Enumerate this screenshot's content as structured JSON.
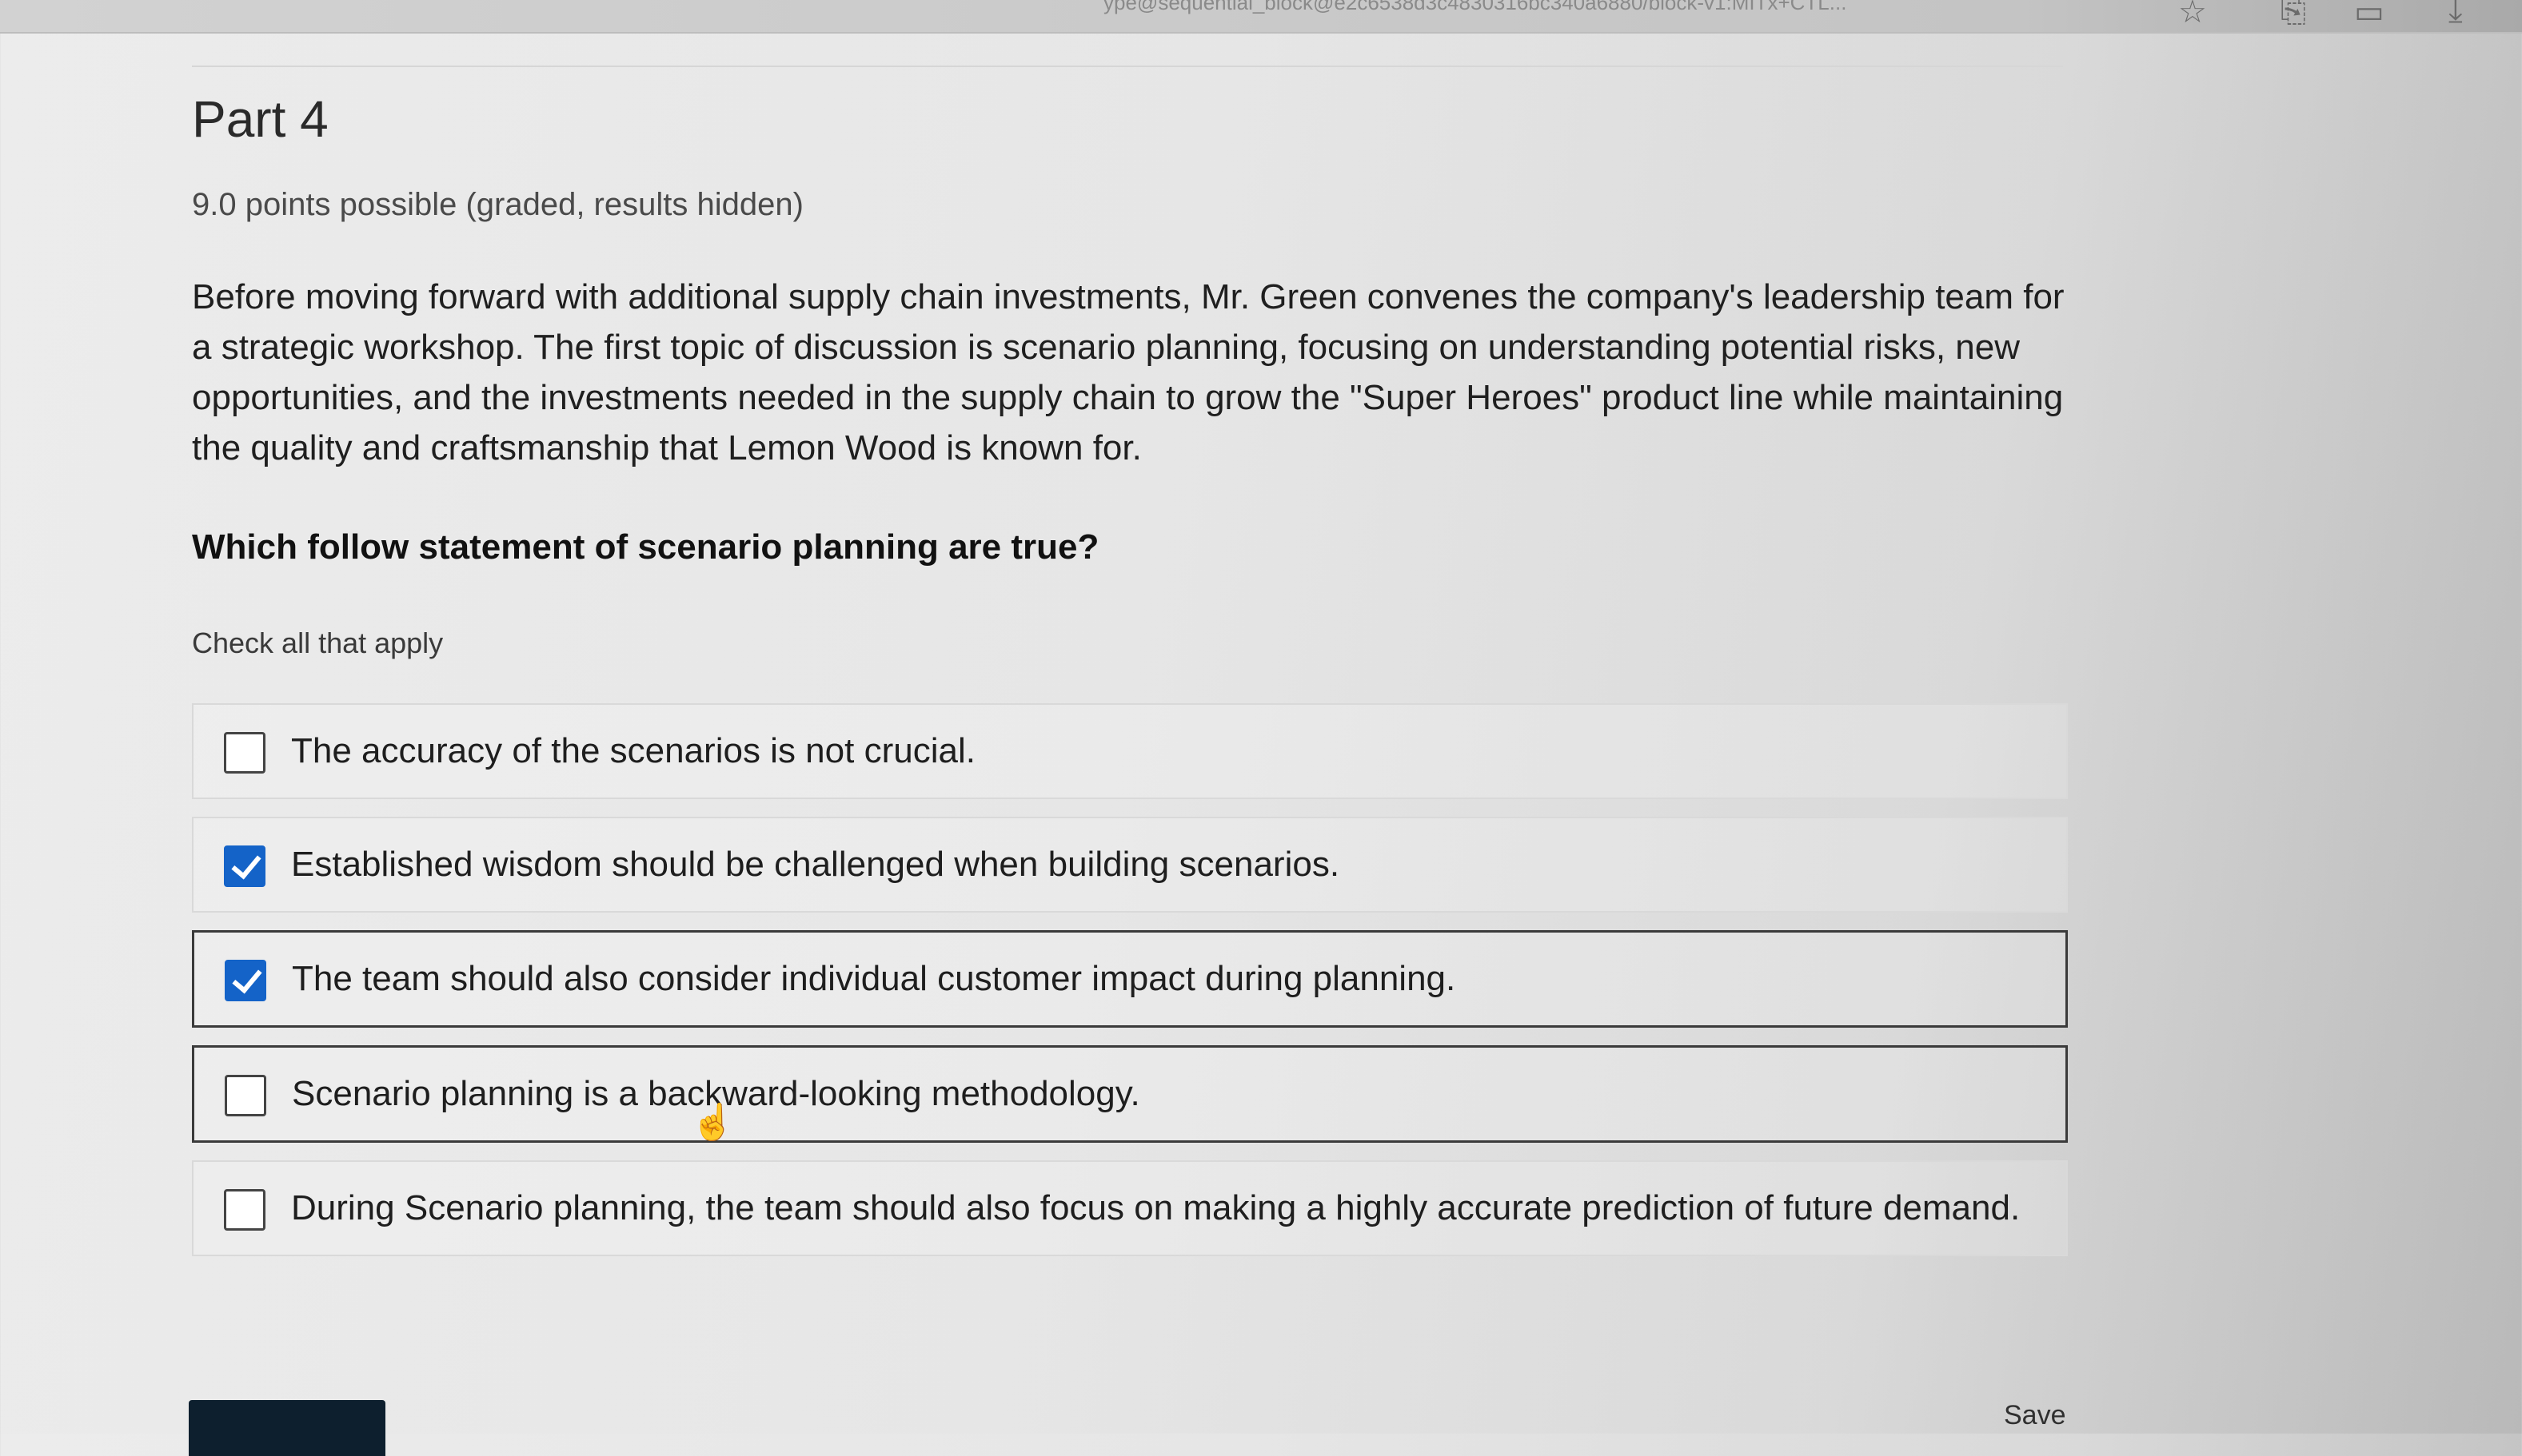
{
  "browser": {
    "url_fragment": "ype@sequential_block@e2c6538d3c4830316bc340a6880/block-v1:MITx+CTL..."
  },
  "part": {
    "title": "Part 4",
    "points": "9.0 points possible (graded, results hidden)"
  },
  "scenario_text": "Before moving forward with additional supply chain investments, Mr. Green convenes the company's leadership team for a strategic workshop. The first topic of discussion is scenario planning, focusing on understanding potential risks, new opportunities, and the investments needed in the supply chain to grow the \"Super Heroes\" product line while maintaining the quality and craftsmanship that Lemon Wood is known for.",
  "question": "Which follow statement of scenario planning are true?",
  "instruction": "Check all that apply",
  "options": [
    {
      "label": "The accuracy of the scenarios is not crucial.",
      "checked": false
    },
    {
      "label": "Established wisdom should be challenged when building scenarios.",
      "checked": true
    },
    {
      "label": "The team should also consider individual customer impact during planning.",
      "checked": true
    },
    {
      "label": "Scenario planning is a backward-looking methodology.",
      "checked": false
    },
    {
      "label": "During Scenario planning, the team should also focus on making a highly accurate prediction of future demand.",
      "checked": false
    }
  ],
  "actions": {
    "save_label": "Save"
  },
  "icons": [
    "star-icon",
    "tab-icon",
    "window-icon",
    "download-icon",
    "pointer-cursor-icon"
  ],
  "colors": {
    "checkbox_checked": "#1463c8",
    "submit_button": "#0d1f2e"
  }
}
